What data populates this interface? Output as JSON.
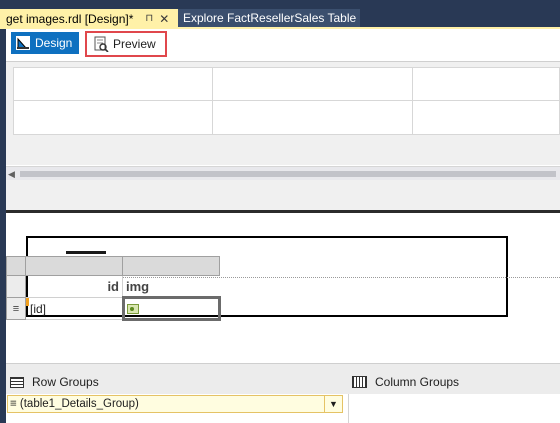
{
  "tabs": [
    {
      "label": "get images.rdl [Design]*",
      "pin": "⊓",
      "close": "✕"
    },
    {
      "label": "Explore FactResellerSales Table"
    }
  ],
  "view_tabs": {
    "design_label": "Design",
    "preview_label": "Preview"
  },
  "tablix": {
    "headers": [
      "id",
      "img"
    ],
    "row_handle": "≡",
    "detail_row": {
      "id": "[id]"
    }
  },
  "groups": {
    "row_groups_label": "Row Groups",
    "column_groups_label": "Column Groups",
    "row_group_item": "≡ (table1_Details_Group)"
  },
  "colors": {
    "active_tab": "#fff1a8",
    "design_button": "#0e70c0",
    "preview_highlight": "#e0474c"
  }
}
